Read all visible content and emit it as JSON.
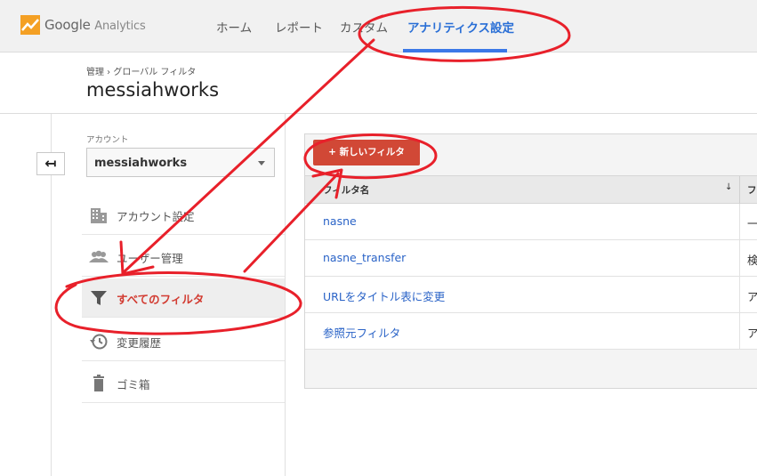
{
  "topbar": {
    "logo_google": "Google",
    "logo_analytics": "Analytics",
    "nav": [
      "ホーム",
      "レポート",
      "カスタム",
      "アナリティクス設定"
    ],
    "active_nav_index": 3,
    "accent_color": "#3b78e7"
  },
  "header": {
    "breadcrumb": "管理 › グローバル フィルタ",
    "title": "messiahworks"
  },
  "sidebar": {
    "back_icon": "back-arrow-icon",
    "account_label": "アカウント",
    "account_value": "messiahworks",
    "items": [
      {
        "label": "アカウント設定",
        "icon": "building-icon"
      },
      {
        "label": "ユーザー管理",
        "icon": "people-icon"
      },
      {
        "label": "すべてのフィルタ",
        "icon": "filter-icon",
        "active": true
      },
      {
        "label": "変更履歴",
        "icon": "history-icon"
      },
      {
        "label": "ゴミ箱",
        "icon": "trash-icon"
      }
    ]
  },
  "main": {
    "new_filter_button": "+ 新しいフィルタ",
    "table": {
      "col_name": "フィルタ名",
      "sort_indicator": "↓",
      "col_type": "フ",
      "rows": [
        {
          "name": "nasne",
          "type": "一"
        },
        {
          "name": "nasne_transfer",
          "type": "検"
        },
        {
          "name": "URLをタイトル表に変更",
          "type": "ア"
        },
        {
          "name": "参照元フィルタ",
          "type": "ア"
        }
      ]
    }
  },
  "annotation_color": "#e8202a"
}
